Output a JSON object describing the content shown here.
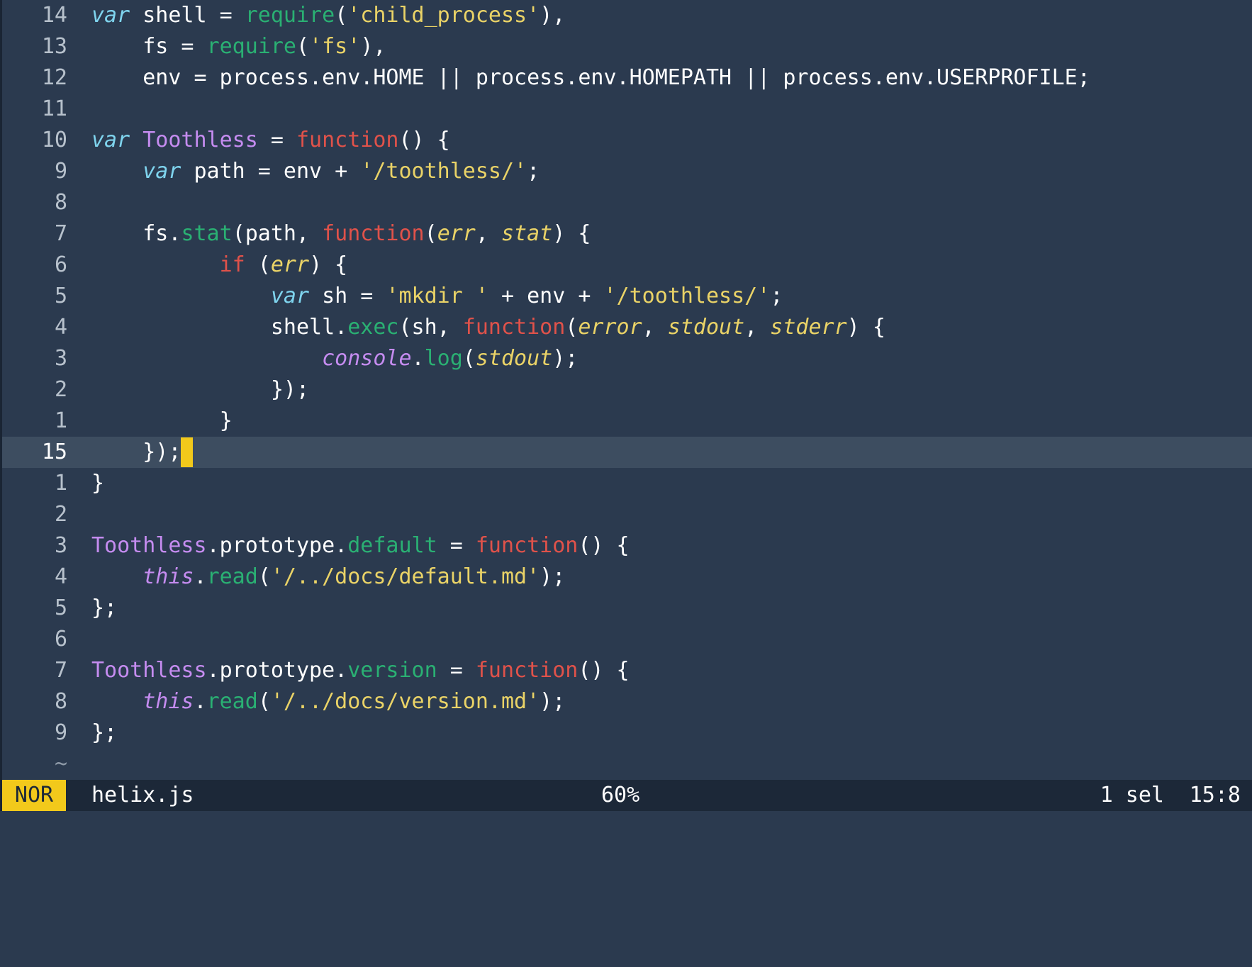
{
  "editor": {
    "lines": [
      {
        "num": "14",
        "current": false,
        "tokens": [
          {
            "t": "var",
            "c": "keyword"
          },
          {
            "t": " shell = ",
            "c": "plain"
          },
          {
            "t": "require",
            "c": "builtin"
          },
          {
            "t": "(",
            "c": "plain"
          },
          {
            "t": "'child_process'",
            "c": "string"
          },
          {
            "t": "),",
            "c": "plain"
          }
        ]
      },
      {
        "num": "13",
        "current": false,
        "tokens": [
          {
            "t": "    fs = ",
            "c": "plain"
          },
          {
            "t": "require",
            "c": "builtin"
          },
          {
            "t": "(",
            "c": "plain"
          },
          {
            "t": "'fs'",
            "c": "string"
          },
          {
            "t": "),",
            "c": "plain"
          }
        ]
      },
      {
        "num": "12",
        "current": false,
        "tokens": [
          {
            "t": "    env = process.env.HOME || process.env.HOMEPATH || process.env.USERPROFILE;",
            "c": "plain"
          }
        ]
      },
      {
        "num": "11",
        "current": false,
        "tokens": []
      },
      {
        "num": "10",
        "current": false,
        "tokens": [
          {
            "t": "var",
            "c": "keyword"
          },
          {
            "t": " ",
            "c": "plain"
          },
          {
            "t": "Toothless",
            "c": "type"
          },
          {
            "t": " = ",
            "c": "plain"
          },
          {
            "t": "function",
            "c": "func-kw"
          },
          {
            "t": "() {",
            "c": "plain"
          }
        ]
      },
      {
        "num": "9",
        "current": false,
        "tokens": [
          {
            "t": "    ",
            "c": "plain"
          },
          {
            "t": "var",
            "c": "keyword"
          },
          {
            "t": " path = env + ",
            "c": "plain"
          },
          {
            "t": "'/toothless/'",
            "c": "string"
          },
          {
            "t": ";",
            "c": "plain"
          }
        ]
      },
      {
        "num": "8",
        "current": false,
        "tokens": []
      },
      {
        "num": "7",
        "current": false,
        "tokens": [
          {
            "t": "    fs.",
            "c": "plain"
          },
          {
            "t": "stat",
            "c": "builtin"
          },
          {
            "t": "(path, ",
            "c": "plain"
          },
          {
            "t": "function",
            "c": "func-kw"
          },
          {
            "t": "(",
            "c": "plain"
          },
          {
            "t": "err",
            "c": "param"
          },
          {
            "t": ", ",
            "c": "plain"
          },
          {
            "t": "stat",
            "c": "param"
          },
          {
            "t": ") {",
            "c": "plain"
          }
        ]
      },
      {
        "num": "6",
        "current": false,
        "tokens": [
          {
            "t": "          ",
            "c": "plain"
          },
          {
            "t": "if",
            "c": "func-kw"
          },
          {
            "t": " (",
            "c": "plain"
          },
          {
            "t": "err",
            "c": "param"
          },
          {
            "t": ") {",
            "c": "plain"
          }
        ]
      },
      {
        "num": "5",
        "current": false,
        "tokens": [
          {
            "t": "              ",
            "c": "plain"
          },
          {
            "t": "var",
            "c": "keyword"
          },
          {
            "t": " sh = ",
            "c": "plain"
          },
          {
            "t": "'mkdir '",
            "c": "string"
          },
          {
            "t": " + env + ",
            "c": "plain"
          },
          {
            "t": "'/toothless/'",
            "c": "string"
          },
          {
            "t": ";",
            "c": "plain"
          }
        ]
      },
      {
        "num": "4",
        "current": false,
        "tokens": [
          {
            "t": "              shell.",
            "c": "plain"
          },
          {
            "t": "exec",
            "c": "builtin"
          },
          {
            "t": "(sh, ",
            "c": "plain"
          },
          {
            "t": "function",
            "c": "func-kw"
          },
          {
            "t": "(",
            "c": "plain"
          },
          {
            "t": "error",
            "c": "param"
          },
          {
            "t": ", ",
            "c": "plain"
          },
          {
            "t": "stdout",
            "c": "param"
          },
          {
            "t": ", ",
            "c": "plain"
          },
          {
            "t": "stderr",
            "c": "param"
          },
          {
            "t": ") {",
            "c": "plain"
          }
        ]
      },
      {
        "num": "3",
        "current": false,
        "tokens": [
          {
            "t": "                  ",
            "c": "plain"
          },
          {
            "t": "console",
            "c": "this"
          },
          {
            "t": ".",
            "c": "plain"
          },
          {
            "t": "log",
            "c": "builtin"
          },
          {
            "t": "(",
            "c": "plain"
          },
          {
            "t": "stdout",
            "c": "param"
          },
          {
            "t": ");",
            "c": "plain"
          }
        ]
      },
      {
        "num": "2",
        "current": false,
        "tokens": [
          {
            "t": "              });",
            "c": "plain"
          }
        ]
      },
      {
        "num": "1",
        "current": false,
        "tokens": [
          {
            "t": "          }",
            "c": "plain"
          }
        ]
      },
      {
        "num": "15",
        "current": true,
        "tokens": [
          {
            "t": "    });",
            "c": "plain"
          }
        ]
      },
      {
        "num": "1",
        "current": false,
        "tokens": [
          {
            "t": "}",
            "c": "plain"
          }
        ]
      },
      {
        "num": "2",
        "current": false,
        "tokens": []
      },
      {
        "num": "3",
        "current": false,
        "tokens": [
          {
            "t": "Toothless",
            "c": "type"
          },
          {
            "t": ".prototype.",
            "c": "plain"
          },
          {
            "t": "default",
            "c": "builtin"
          },
          {
            "t": " = ",
            "c": "plain"
          },
          {
            "t": "function",
            "c": "func-kw"
          },
          {
            "t": "() {",
            "c": "plain"
          }
        ]
      },
      {
        "num": "4",
        "current": false,
        "tokens": [
          {
            "t": "    ",
            "c": "plain"
          },
          {
            "t": "this",
            "c": "this"
          },
          {
            "t": ".",
            "c": "plain"
          },
          {
            "t": "read",
            "c": "builtin"
          },
          {
            "t": "(",
            "c": "plain"
          },
          {
            "t": "'/../docs/default.md'",
            "c": "string"
          },
          {
            "t": ");",
            "c": "plain"
          }
        ]
      },
      {
        "num": "5",
        "current": false,
        "tokens": [
          {
            "t": "};",
            "c": "plain"
          }
        ]
      },
      {
        "num": "6",
        "current": false,
        "tokens": []
      },
      {
        "num": "7",
        "current": false,
        "tokens": [
          {
            "t": "Toothless",
            "c": "type"
          },
          {
            "t": ".prototype.",
            "c": "plain"
          },
          {
            "t": "version",
            "c": "builtin"
          },
          {
            "t": " = ",
            "c": "plain"
          },
          {
            "t": "function",
            "c": "func-kw"
          },
          {
            "t": "() {",
            "c": "plain"
          }
        ]
      },
      {
        "num": "8",
        "current": false,
        "tokens": [
          {
            "t": "    ",
            "c": "plain"
          },
          {
            "t": "this",
            "c": "this"
          },
          {
            "t": ".",
            "c": "plain"
          },
          {
            "t": "read",
            "c": "builtin"
          },
          {
            "t": "(",
            "c": "plain"
          },
          {
            "t": "'/../docs/version.md'",
            "c": "string"
          },
          {
            "t": ");",
            "c": "plain"
          }
        ]
      },
      {
        "num": "9",
        "current": false,
        "tokens": [
          {
            "t": "};",
            "c": "plain"
          }
        ]
      },
      {
        "num": "~",
        "current": false,
        "tilde": true,
        "tokens": []
      }
    ]
  },
  "statusline": {
    "mode": "NOR",
    "filename": "helix.js",
    "percent": "60%",
    "selections": "1 sel",
    "position": "15:8"
  },
  "colors": {
    "background": "#2b3a4f",
    "current_line": "#3d4d60",
    "statusline": "#1c2838",
    "mode_badge": "#f2c91b",
    "cursor": "#f2c91b",
    "keyword": "#7fd4ee",
    "function_keyword": "#e0524a",
    "builtin": "#2ab073",
    "string": "#ead367",
    "type": "#c58cf0"
  }
}
